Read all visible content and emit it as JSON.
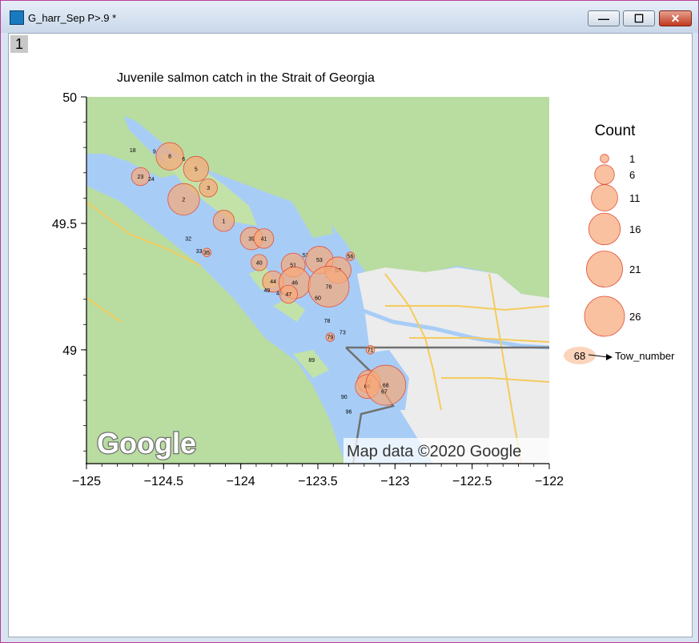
{
  "window": {
    "title": "G_harr_Sep P>.9 *",
    "page_number": "1"
  },
  "map": {
    "attribution": "Map data ©2020 Google",
    "logo_text": "Google"
  },
  "colors": {
    "bubble_fill": "#f7a97a",
    "bubble_stroke": "#e0503a",
    "water": "#a7cdf7",
    "land": "#b9dca0",
    "urban": "#ececec"
  },
  "chart_data": {
    "type": "scatter",
    "title": "Juvenile salmon catch in the Strait of Georgia",
    "xlabel": "",
    "ylabel": "",
    "xlim": [
      -125,
      -122
    ],
    "ylim": [
      48.55,
      50
    ],
    "xticks": [
      -125,
      -124.5,
      -124,
      -123.5,
      -123,
      -122.5,
      -122
    ],
    "xtick_labels": [
      "−125",
      "−124.5",
      "−124",
      "−123.5",
      "−123",
      "−122.5",
      "−122"
    ],
    "yticks": [
      49,
      49.5,
      50
    ],
    "ytick_labels": [
      "49",
      "49.5",
      "50"
    ],
    "legend": {
      "title": "Count",
      "position": "right",
      "entries": [
        {
          "label": "1",
          "count": 1
        },
        {
          "label": "6",
          "count": 6
        },
        {
          "label": "11",
          "count": 11
        },
        {
          "label": "16",
          "count": 16
        },
        {
          "label": "21",
          "count": 21
        },
        {
          "label": "26",
          "count": 26
        }
      ],
      "label_key": {
        "sample": "68",
        "text": "Tow_number"
      }
    },
    "points": [
      {
        "tow": "18",
        "lon": -124.7,
        "lat": 49.79,
        "count": 0
      },
      {
        "tow": "9",
        "lon": -124.56,
        "lat": 49.785,
        "count": 0
      },
      {
        "tow": "8",
        "lon": -124.46,
        "lat": 49.765,
        "count": 12
      },
      {
        "tow": "6",
        "lon": -124.37,
        "lat": 49.755,
        "count": 0
      },
      {
        "tow": "5",
        "lon": -124.29,
        "lat": 49.715,
        "count": 10
      },
      {
        "tow": "23",
        "lon": -124.65,
        "lat": 49.685,
        "count": 5
      },
      {
        "tow": "24",
        "lon": -124.58,
        "lat": 49.675,
        "count": 0
      },
      {
        "tow": "3",
        "lon": -124.21,
        "lat": 49.64,
        "count": 5
      },
      {
        "tow": "2",
        "lon": -124.37,
        "lat": 49.595,
        "count": 16
      },
      {
        "tow": "1",
        "lon": -124.11,
        "lat": 49.51,
        "count": 7
      },
      {
        "tow": "32",
        "lon": -124.34,
        "lat": 49.44,
        "count": 0
      },
      {
        "tow": "33",
        "lon": -124.27,
        "lat": 49.39,
        "count": 0
      },
      {
        "tow": "35",
        "lon": -124.22,
        "lat": 49.385,
        "count": 1
      },
      {
        "tow": "39",
        "lon": -123.93,
        "lat": 49.44,
        "count": 8
      },
      {
        "tow": "41",
        "lon": -123.85,
        "lat": 49.44,
        "count": 6
      },
      {
        "tow": "40",
        "lon": -123.88,
        "lat": 49.345,
        "count": 4
      },
      {
        "tow": "52",
        "lon": -123.58,
        "lat": 49.375,
        "count": 0
      },
      {
        "tow": "53",
        "lon": -123.49,
        "lat": 49.355,
        "count": 12
      },
      {
        "tow": "56",
        "lon": -123.29,
        "lat": 49.37,
        "count": 1
      },
      {
        "tow": "51",
        "lon": -123.66,
        "lat": 49.335,
        "count": 9
      },
      {
        "tow": "58",
        "lon": -123.43,
        "lat": 49.32,
        "count": 0
      },
      {
        "tow": "57",
        "lon": -123.37,
        "lat": 49.315,
        "count": 11
      },
      {
        "tow": "44",
        "lon": -123.79,
        "lat": 49.27,
        "count": 7
      },
      {
        "tow": "46",
        "lon": -123.65,
        "lat": 49.265,
        "count": 16
      },
      {
        "tow": "76",
        "lon": -123.43,
        "lat": 49.25,
        "count": 27
      },
      {
        "tow": "49",
        "lon": -123.83,
        "lat": 49.235,
        "count": 0
      },
      {
        "tow": "48",
        "lon": -123.75,
        "lat": 49.225,
        "count": 0
      },
      {
        "tow": "47",
        "lon": -123.69,
        "lat": 49.22,
        "count": 5
      },
      {
        "tow": "60",
        "lon": -123.5,
        "lat": 49.205,
        "count": 0
      },
      {
        "tow": "78",
        "lon": -123.44,
        "lat": 49.115,
        "count": 0
      },
      {
        "tow": "79",
        "lon": -123.42,
        "lat": 49.05,
        "count": 1
      },
      {
        "tow": "73",
        "lon": -123.34,
        "lat": 49.07,
        "count": 0
      },
      {
        "tow": "71",
        "lon": -123.16,
        "lat": 49.0,
        "count": 1
      },
      {
        "tow": "89",
        "lon": -123.54,
        "lat": 48.96,
        "count": 0
      },
      {
        "tow": "69",
        "lon": -123.17,
        "lat": 48.875,
        "count": 8
      },
      {
        "tow": "66",
        "lon": -123.18,
        "lat": 48.855,
        "count": 9
      },
      {
        "tow": "68",
        "lon": -123.06,
        "lat": 48.86,
        "count": 26
      },
      {
        "tow": "67",
        "lon": -123.07,
        "lat": 48.835,
        "count": 0
      },
      {
        "tow": "90",
        "lon": -123.33,
        "lat": 48.815,
        "count": 0
      },
      {
        "tow": "96",
        "lon": -123.3,
        "lat": 48.755,
        "count": 0
      }
    ]
  }
}
